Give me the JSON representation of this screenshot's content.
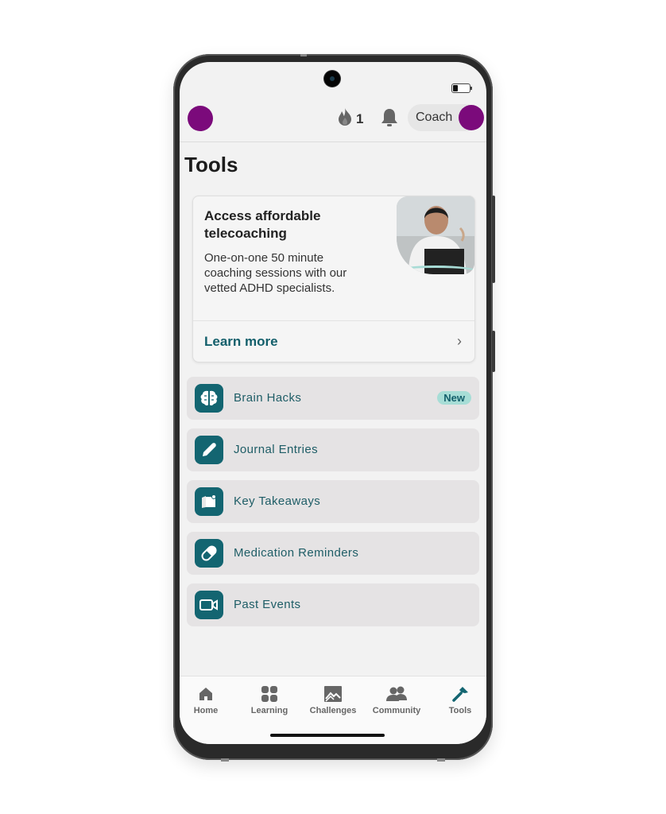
{
  "status_bar": {
    "battery_icon": "battery-low-icon",
    "camera": "front-camera"
  },
  "header": {
    "streak_icon": "flame-icon",
    "streak_count": "1",
    "notifications_icon": "bell-icon",
    "coach_label": "Coach",
    "colors": {
      "avatar": "#7b0a7b"
    }
  },
  "page": {
    "title": "Tools"
  },
  "promo": {
    "title": "Access affordable telecoaching",
    "description": "One-on-one 50 minute coaching sessions with our vetted ADHD specialists.",
    "cta_label": "Learn more",
    "image_alt": "Woman smiling at laptop"
  },
  "tools": [
    {
      "label": "Brain Hacks",
      "icon": "brain-icon",
      "badge": "New"
    },
    {
      "label": "Journal Entries",
      "icon": "pencil-icon"
    },
    {
      "label": "Key Takeaways",
      "icon": "sticky-note-icon"
    },
    {
      "label": "Medication Reminders",
      "icon": "pill-icon"
    },
    {
      "label": "Past Events",
      "icon": "video-camera-icon"
    }
  ],
  "bottom_nav": {
    "items": [
      {
        "label": "Home",
        "icon": "home-icon"
      },
      {
        "label": "Learning",
        "icon": "grid-icon"
      },
      {
        "label": "Challenges",
        "icon": "mountain-image-icon"
      },
      {
        "label": "Community",
        "icon": "people-icon"
      },
      {
        "label": "Tools",
        "icon": "hammer-icon",
        "active": true
      }
    ],
    "colors": {
      "active": "#136571",
      "inactive": "#666666"
    }
  },
  "theme": {
    "primary": "#136571",
    "badge_bg": "#a7ddd6",
    "item_bg": "#e5e3e4"
  }
}
